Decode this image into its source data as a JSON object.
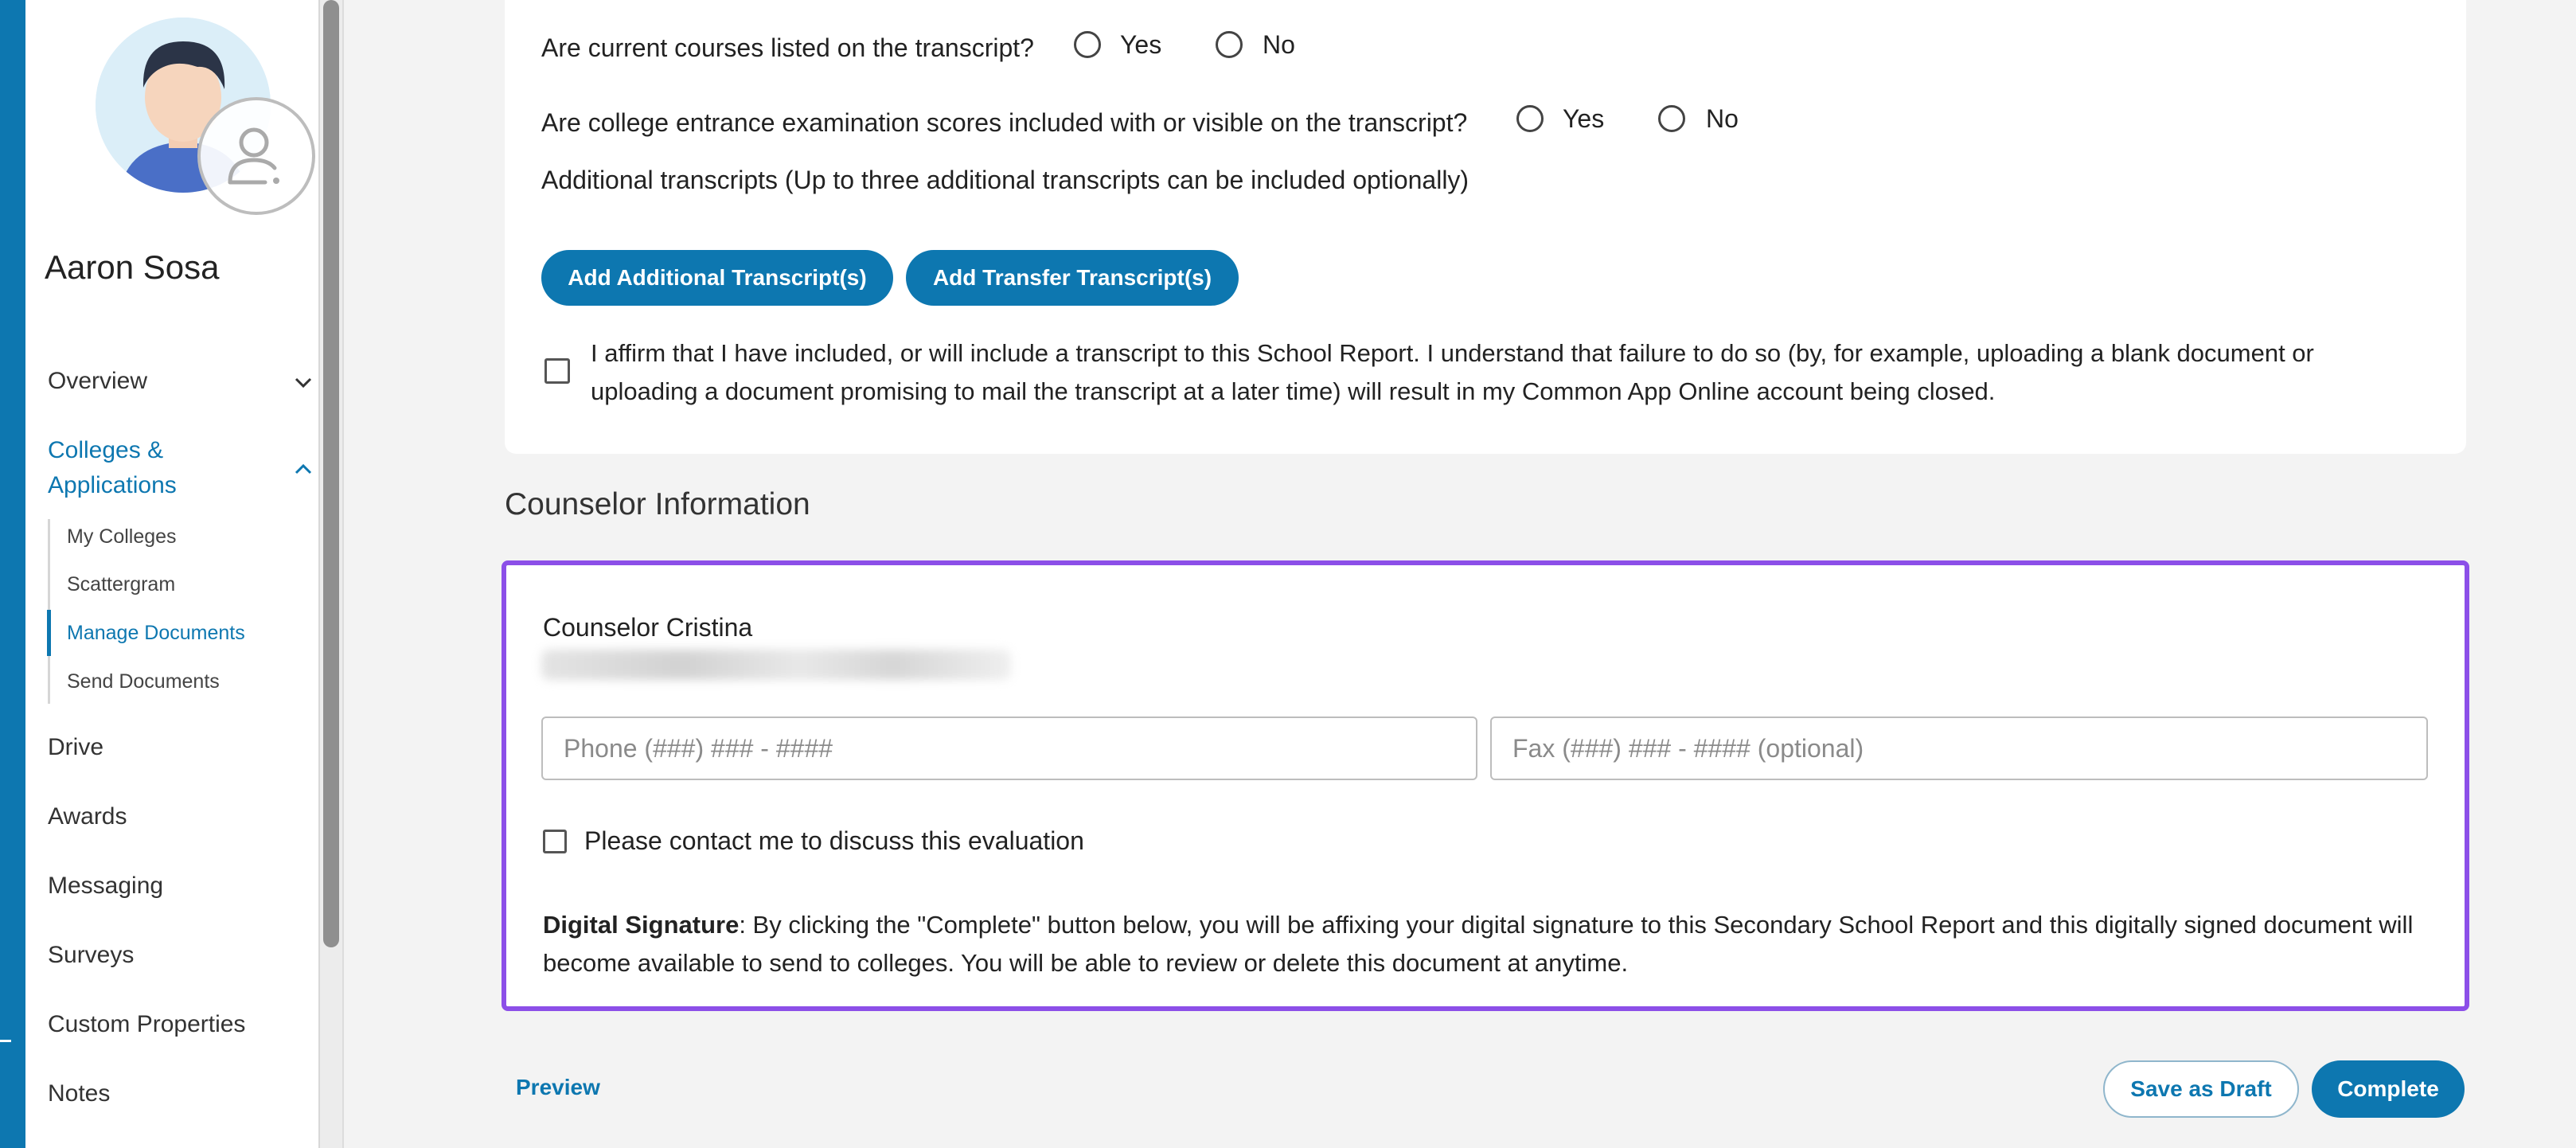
{
  "user": {
    "name": "Aaron Sosa"
  },
  "sidebar": {
    "overview": "Overview",
    "colleges": "Colleges & Applications",
    "sub_items": [
      "My Colleges",
      "Scattergram",
      "Manage Documents",
      "Send Documents"
    ],
    "items": [
      "Drive",
      "Awards",
      "Messaging",
      "Surveys",
      "Custom Properties",
      "Notes"
    ]
  },
  "transcript": {
    "q_current_courses": "Are current courses listed on the transcript?",
    "q_exam_scores": "Are college entrance examination scores included with or visible on the transcript?",
    "yes": "Yes",
    "no": "No",
    "additional_note": "Additional transcripts (Up to three additional transcripts can be included optionally)",
    "add_additional_btn": "Add Additional Transcript(s)",
    "add_transfer_btn": "Add Transfer Transcript(s)",
    "affirm_text": "I affirm that I have included, or will include a transcript to this School Report. I understand that failure to do so (by, for example, uploading a blank document or uploading a document promising to mail the transcript at a later time) will result in my Common App Online account being closed."
  },
  "counselor": {
    "section_title": "Counselor Information",
    "name": "Counselor Cristina",
    "phone_placeholder": "Phone (###) ### - ####",
    "fax_placeholder": "Fax (###) ### - #### (optional)",
    "contact_label": "Please contact me to discuss this evaluation",
    "signature_label": "Digital Signature",
    "signature_text": ": By clicking the \"Complete\" button below, you will be affixing your digital signature to this Secondary School Report and this digitally signed document will become available to send to colleges. You will be able to review or delete this document at anytime."
  },
  "footer": {
    "preview": "Preview",
    "save_draft": "Save as Draft",
    "complete": "Complete"
  },
  "colors": {
    "brand": "#0d77b0",
    "highlight": "#8c4fe8"
  }
}
